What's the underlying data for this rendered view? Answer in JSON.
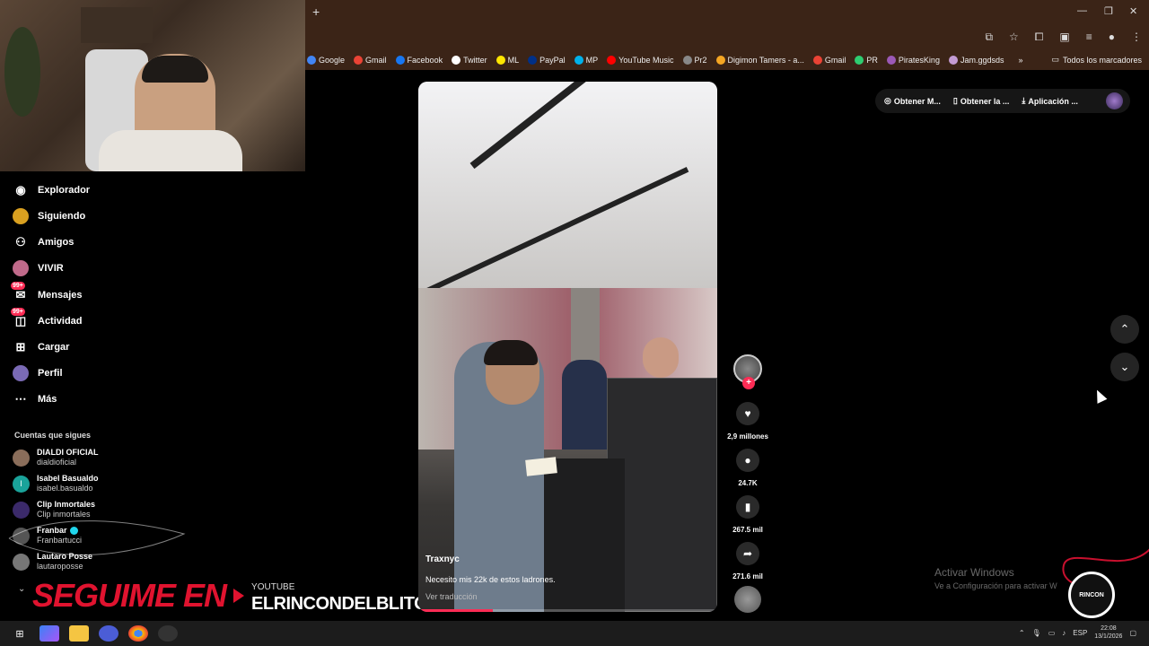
{
  "browser": {
    "bookmarks": [
      {
        "label": "Google",
        "color": "#4285f4"
      },
      {
        "label": "Gmail",
        "color": "#ea4335"
      },
      {
        "label": "Facebook",
        "color": "#1877f2"
      },
      {
        "label": "Twitter",
        "color": "#ffffff"
      },
      {
        "label": "ML",
        "color": "#ffe600"
      },
      {
        "label": "PayPal",
        "color": "#003087"
      },
      {
        "label": "MP",
        "color": "#00b1ea"
      },
      {
        "label": "YouTube Music",
        "color": "#ff0000"
      },
      {
        "label": "Pr2",
        "color": "#888888"
      },
      {
        "label": "Digimon Tamers - a...",
        "color": "#f5a623"
      },
      {
        "label": "Gmail",
        "color": "#ea4335"
      },
      {
        "label": "PR",
        "color": "#2ecc71"
      },
      {
        "label": "PiratesKing",
        "color": "#9b59b6"
      },
      {
        "label": "Jam.ggdsds",
        "color": "#c39bd3"
      }
    ],
    "bookmarks_more": "»",
    "all_bookmarks": "Todos los marcadores"
  },
  "sidebar": {
    "nav": [
      {
        "label": "Explorador",
        "icon": "compass-icon"
      },
      {
        "label": "Siguiendo",
        "icon": "following-icon"
      },
      {
        "label": "Amigos",
        "icon": "friends-icon"
      },
      {
        "label": "VIVIR",
        "icon": "live-icon"
      },
      {
        "label": "Mensajes",
        "icon": "messages-icon",
        "badge": "99+"
      },
      {
        "label": "Actividad",
        "icon": "activity-icon",
        "badge": "99+"
      },
      {
        "label": "Cargar",
        "icon": "upload-icon"
      },
      {
        "label": "Perfil",
        "icon": "profile-icon"
      },
      {
        "label": "Más",
        "icon": "more-icon"
      }
    ],
    "following_title": "Cuentas que sigues",
    "accounts": [
      {
        "name": "DIALDI OFICIAL",
        "user": "dialdioficial",
        "color": "#8a6d5a"
      },
      {
        "name": "Isabel Basualdo",
        "user": "isabel.basualdo",
        "color": "#1aa39a",
        "initial": "I"
      },
      {
        "name": "Clip Inmortales",
        "user": "Clip inmortales",
        "color": "#3b2a6a"
      },
      {
        "name": "Franbar",
        "user": "Franbartucci",
        "color": "#555555",
        "verified": true
      },
      {
        "name": "Lautaro Posse",
        "user": "lautaroposse",
        "color": "#777777"
      }
    ]
  },
  "promo": {
    "big": "SEGUIME EN",
    "small": "YOUTUBE",
    "channel": "ELRINCONDELBLITO"
  },
  "video": {
    "author": "Traxnyc",
    "description": "Necesito mis 22k de estos ladrones.",
    "translate": "Ver traducción",
    "progress": 0.25
  },
  "actions": {
    "likes": "2,9 millones",
    "comments": "24.7K",
    "saves": "267.5 mil",
    "shares": "271.6 mil"
  },
  "top_pills": {
    "pill1": "Obtener M...",
    "pill2": "Obtener la ...",
    "pill3": "Aplicación ..."
  },
  "watermark": {
    "line1": "Activar Windows",
    "line2": "Ve a Configuración para activar W"
  },
  "logo_text": "RINCON",
  "taskbar": {
    "lang": "ESP",
    "time": "22:08",
    "date": "13/1/2026"
  }
}
